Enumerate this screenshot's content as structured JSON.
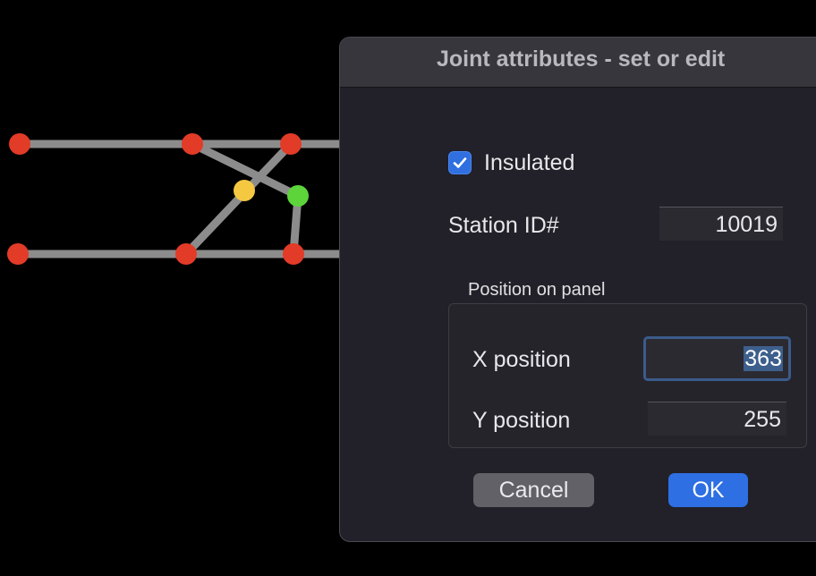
{
  "dialog": {
    "title": "Joint attributes - set or edit",
    "insulated_label": "Insulated",
    "insulated_checked": true,
    "station_id_label": "Station ID#",
    "station_id_value": "10019",
    "position_group_label": "Position on panel",
    "x_label": "X position",
    "x_value": "363",
    "y_label": "Y position",
    "y_value": "255",
    "cancel_label": "Cancel",
    "ok_label": "OK"
  },
  "colors": {
    "track": "#8c8c8c",
    "joint_red": "#e23b27",
    "joint_yellow": "#f5c842",
    "joint_green": "#5cd43a",
    "accent_blue": "#2e6fe3"
  },
  "track_panel": {
    "joints": [
      {
        "color": "red"
      },
      {
        "color": "red"
      },
      {
        "color": "red"
      },
      {
        "color": "yellow"
      },
      {
        "color": "green"
      },
      {
        "color": "red"
      },
      {
        "color": "red"
      },
      {
        "color": "red"
      }
    ]
  }
}
